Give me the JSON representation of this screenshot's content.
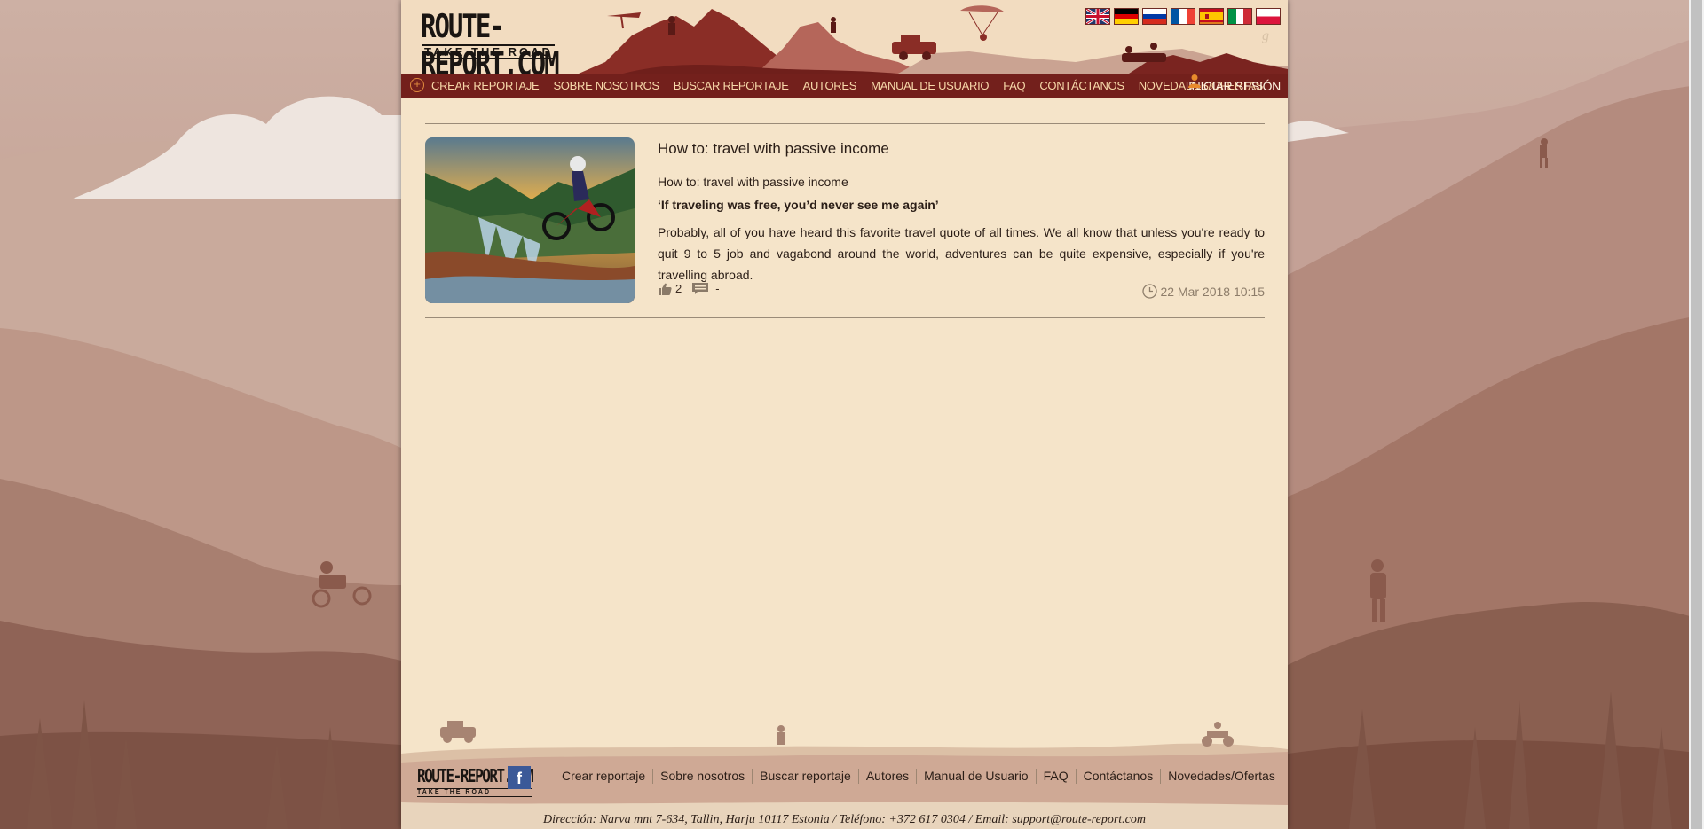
{
  "site": {
    "logo_main": "ROUTE-REPORT.COM",
    "logo_sub": "TAKE THE ROAD"
  },
  "languages": [
    {
      "code": "en",
      "name": "English",
      "active": false
    },
    {
      "code": "de",
      "name": "Deutsch",
      "active": false
    },
    {
      "code": "ru",
      "name": "Русский",
      "active": false
    },
    {
      "code": "fr",
      "name": "Français",
      "active": false
    },
    {
      "code": "es",
      "name": "Español",
      "active": true
    },
    {
      "code": "it",
      "name": "Italiano",
      "active": false
    },
    {
      "code": "pl",
      "name": "Polski",
      "active": false
    }
  ],
  "nav": {
    "items": [
      "Crear reportaje",
      "Sobre nosotros",
      "Buscar reportaje",
      "Autores",
      "Manual de usuario",
      "FAQ",
      "Contáctanos",
      "Novedades/Ofertas"
    ],
    "login_label": "INICIAR SESIÓN"
  },
  "post": {
    "title": "How to: travel with passive income",
    "subtitle": "How to: travel with passive income",
    "quote": "‘If traveling was free, you’d never see me again’",
    "excerpt": "Probably, all of you have heard this favorite travel quote of all times. We all know that unless you're ready to quit 9 to 5 job and vagabond around the world, adventures can be quite expensive, especially if you're travelling abroad.",
    "likes": "2",
    "comments": "-",
    "date": "22 Mar 2018 10:15"
  },
  "footer": {
    "logo_main": "ROUTE-REPORT.COM",
    "logo_sub": "TAKE THE ROAD",
    "facebook": "f",
    "links": [
      "Crear reportaje",
      "Sobre nosotros",
      "Buscar reportaje",
      "Autores",
      "Manual de Usuario",
      "FAQ",
      "Contáctanos",
      "Novedades/Ofertas"
    ],
    "address": "Dirección: Narva mnt 7-634, Tallin, Harju 10117 Estonia / Teléfono: +372 617 0304 / Email: support@route-report.com"
  },
  "colors": {
    "nav_bg": "#73201c",
    "page_bg": "#f5e4c9",
    "nav_text": "#f7d8a9"
  }
}
